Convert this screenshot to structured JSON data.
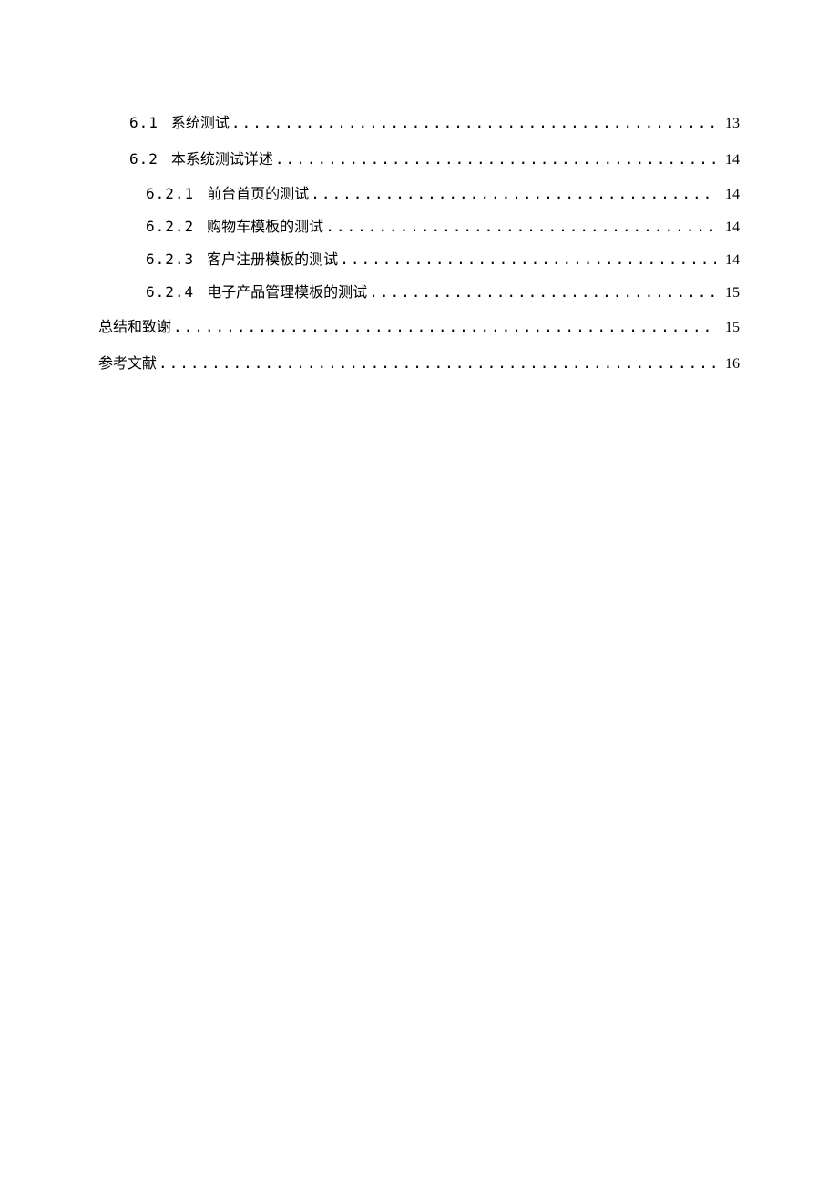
{
  "toc": [
    {
      "level": 1,
      "num": "6.1",
      "title": "系统测试",
      "page": "13"
    },
    {
      "level": 1,
      "num": "6.2",
      "title": "本系统测试详述",
      "page": "14"
    },
    {
      "level": 2,
      "num": "6.2.1",
      "title": "前台首页的测试",
      "page": "14"
    },
    {
      "level": 2,
      "num": "6.2.2",
      "title": "购物车模板的测试",
      "page": "14"
    },
    {
      "level": 2,
      "num": "6.2.3",
      "title": "客户注册模板的测试",
      "page": "14"
    },
    {
      "level": 2,
      "num": "6.2.4",
      "title": "电子产品管理模板的测试",
      "page": "15"
    },
    {
      "level": 0,
      "num": "",
      "title": "总结和致谢",
      "page": "15"
    },
    {
      "level": 0,
      "num": "",
      "title": "参考文献",
      "page": "16"
    }
  ]
}
